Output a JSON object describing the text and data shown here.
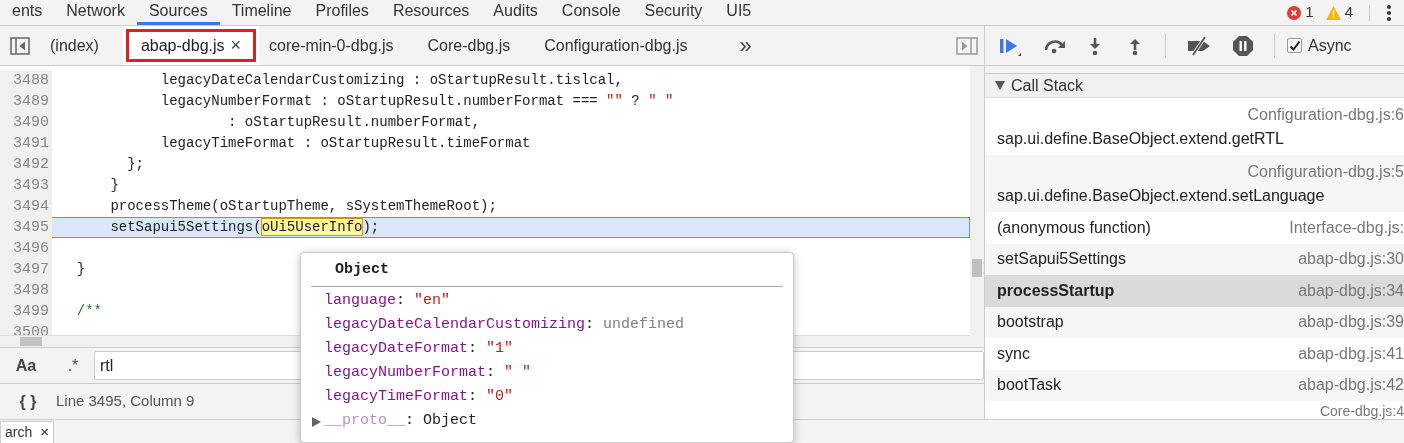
{
  "top_tabs": [
    {
      "label": "ents",
      "selected": false
    },
    {
      "label": "Network",
      "selected": false
    },
    {
      "label": "Sources",
      "selected": true
    },
    {
      "label": "Timeline",
      "selected": false
    },
    {
      "label": "Profiles",
      "selected": false
    },
    {
      "label": "Resources",
      "selected": false
    },
    {
      "label": "Audits",
      "selected": false
    },
    {
      "label": "Console",
      "selected": false
    },
    {
      "label": "Security",
      "selected": false
    },
    {
      "label": "UI5",
      "selected": false
    }
  ],
  "counts": {
    "errors": "1",
    "warnings": "4"
  },
  "source_tabs": [
    {
      "label": "(index)",
      "selected": false,
      "closable": false
    },
    {
      "label": "abap-dbg.js",
      "selected": true,
      "closable": true,
      "close": "×"
    },
    {
      "label": "core-min-0-dbg.js",
      "selected": false,
      "closable": false
    },
    {
      "label": "Core-dbg.js",
      "selected": false,
      "closable": false
    },
    {
      "label": "Configuration-dbg.js",
      "selected": false,
      "closable": false
    }
  ],
  "overflow": "»",
  "async": {
    "label": "Async",
    "checked": true
  },
  "code": {
    "lines": [
      {
        "number": "3488",
        "selected": false,
        "tokens": [
          {
            "text": "            legacyDateCalendarCustomizing : oStartupResult.tislcal,",
            "kind": "plain"
          }
        ]
      },
      {
        "number": "3489",
        "selected": false,
        "tokens": [
          {
            "text": "            legacyNumberFormat : oStartupResult.numberFormat === ",
            "kind": "plain"
          },
          {
            "text": "\"\"",
            "kind": "string"
          },
          {
            "text": " ? ",
            "kind": "plain"
          },
          {
            "text": "\" \"",
            "kind": "string"
          }
        ]
      },
      {
        "number": "3490",
        "selected": false,
        "tokens": [
          {
            "text": "                    : oStartupResult.numberFormat,",
            "kind": "plain"
          }
        ]
      },
      {
        "number": "3491",
        "selected": false,
        "tokens": [
          {
            "text": "            legacyTimeFormat : oStartupResult.timeFormat",
            "kind": "plain"
          }
        ]
      },
      {
        "number": "3492",
        "selected": false,
        "tokens": [
          {
            "text": "        };",
            "kind": "plain"
          }
        ]
      },
      {
        "number": "3493",
        "selected": false,
        "tokens": [
          {
            "text": "      }",
            "kind": "plain"
          }
        ]
      },
      {
        "number": "3494",
        "selected": false,
        "tokens": [
          {
            "text": "      processTheme(oStartupTheme, sSystemThemeRoot);",
            "kind": "plain"
          }
        ]
      },
      {
        "number": "3495",
        "selected": true,
        "tokens": [
          {
            "text": "      setSapui5Settings(",
            "kind": "plain"
          },
          {
            "text": "oUi5UserInfo",
            "kind": "match"
          },
          {
            "text": ");",
            "kind": "plain"
          }
        ]
      },
      {
        "number": "3496",
        "selected": false
      },
      {
        "number": "3497",
        "selected": false,
        "tokens": [
          {
            "text": "  }",
            "kind": "plain"
          }
        ]
      },
      {
        "number": "3498",
        "selected": false
      },
      {
        "number": "3499",
        "selected": false,
        "tokens": [
          {
            "text": "  /**",
            "kind": "comment"
          }
        ]
      },
      {
        "number": "3500",
        "selected": false
      }
    ]
  },
  "tooltip": {
    "title": "Object",
    "separator": ": ",
    "properties": [
      {
        "key": "language",
        "value": "\"en\"",
        "kind": "string"
      },
      {
        "key": "legacyDateCalendarCustomizing",
        "value": "undefined",
        "kind": "undefined"
      },
      {
        "key": "legacyDateFormat",
        "value": "\"1\"",
        "kind": "string"
      },
      {
        "key": "legacyNumberFormat",
        "value": "\" \"",
        "kind": "string"
      },
      {
        "key": "legacyTimeFormat",
        "value": "\"0\"",
        "kind": "string"
      }
    ],
    "proto": {
      "key": "__proto__",
      "value": "Object",
      "expanded": false
    }
  },
  "call_stack": {
    "title": "Call Stack",
    "expanded": true,
    "frames": [
      {
        "function": "sap.ui.define.BaseObject.extend.getRTL",
        "location": "Configuration-dbg.js:6",
        "selected": false,
        "kind": "two_line"
      },
      {
        "function": "sap.ui.define.BaseObject.extend.setLanguage",
        "location": "Configuration-dbg.js:5",
        "selected": false,
        "kind": "two_line"
      },
      {
        "function": "(anonymous function)",
        "location": "Interface-dbg.js:",
        "selected": false,
        "kind": "one_line"
      },
      {
        "function": "setSapui5Settings",
        "location": "abap-dbg.js:30",
        "selected": false,
        "kind": "one_line"
      },
      {
        "function": "processStartup",
        "location": "abap-dbg.js:34",
        "selected": true,
        "kind": "one_line"
      },
      {
        "function": "bootstrap",
        "location": "abap-dbg.js:39",
        "selected": false,
        "kind": "one_line"
      },
      {
        "function": "sync",
        "location": "abap-dbg.js:41",
        "selected": false,
        "kind": "one_line"
      },
      {
        "function": "bootTask",
        "location": "abap-dbg.js:42",
        "selected": false,
        "kind": "one_line"
      },
      {
        "location": "Core-dbg.js:4",
        "selected": false,
        "kind": "location_only"
      }
    ]
  },
  "search": {
    "case_label": "Aa",
    "regex_label": ".*",
    "value": "rtl"
  },
  "status": {
    "format_label": "{ }",
    "position": "Line 3495, Column 9"
  },
  "drawer_tab": {
    "label": "arch",
    "close": "×"
  }
}
